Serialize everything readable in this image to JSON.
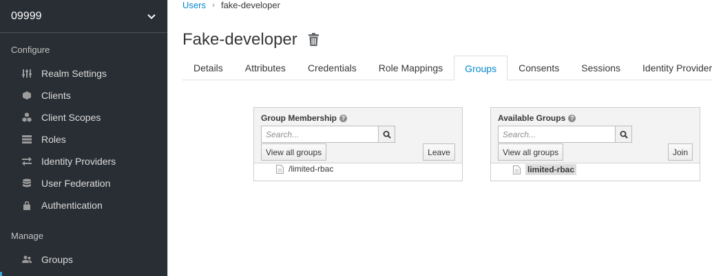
{
  "sidebar": {
    "realm": "09999",
    "sections": [
      {
        "label": "Configure"
      },
      {
        "label": "Manage"
      }
    ],
    "items": [
      {
        "label": "Realm Settings",
        "icon": "sliders-icon"
      },
      {
        "label": "Clients",
        "icon": "cube-icon"
      },
      {
        "label": "Client Scopes",
        "icon": "cubes-icon"
      },
      {
        "label": "Roles",
        "icon": "list-icon"
      },
      {
        "label": "Identity Providers",
        "icon": "exchange-icon"
      },
      {
        "label": "User Federation",
        "icon": "database-icon"
      },
      {
        "label": "Authentication",
        "icon": "lock-icon"
      },
      {
        "label": "Groups",
        "icon": "users-icon"
      }
    ]
  },
  "breadcrumb": {
    "parent": "Users",
    "separator": "›",
    "current": "fake-developer"
  },
  "page": {
    "title": "Fake-developer"
  },
  "tabs": [
    {
      "label": "Details"
    },
    {
      "label": "Attributes"
    },
    {
      "label": "Credentials"
    },
    {
      "label": "Role Mappings"
    },
    {
      "label": "Groups",
      "active": true
    },
    {
      "label": "Consents"
    },
    {
      "label": "Sessions"
    },
    {
      "label": "Identity Provider Links"
    }
  ],
  "membership": {
    "title": "Group Membership",
    "search_placeholder": "Search...",
    "view_all": "View all groups",
    "action": "Leave",
    "items": [
      "/limited-rbac"
    ]
  },
  "available": {
    "title": "Available Groups",
    "search_placeholder": "Search...",
    "view_all": "View all groups",
    "action": "Join",
    "items": [
      "limited-rbac"
    ]
  },
  "colors": {
    "sidebar_bg": "#292e34",
    "link": "#0088ce"
  }
}
